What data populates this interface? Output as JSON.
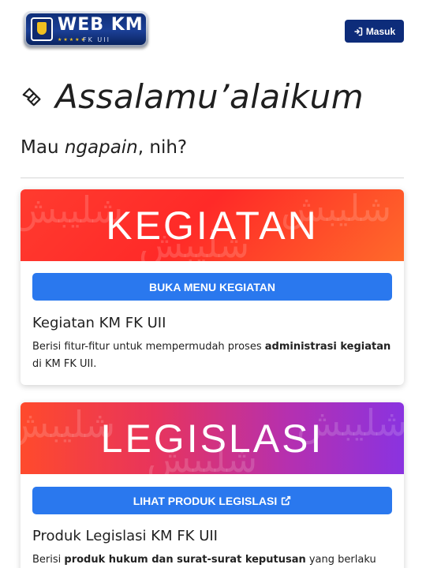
{
  "header": {
    "logo": {
      "main_text": "WEB KM",
      "sub_text": "FK UII",
      "stars": "★★★★★"
    },
    "login_label": "Masuk"
  },
  "greeting": {
    "text": "Assalamu’alaikum"
  },
  "question": {
    "prefix": "Mau ",
    "emphasis": "ngapain",
    "suffix": ", nih?"
  },
  "cards": [
    {
      "banner_title": "KEGIATAN",
      "button_label": "BUKA MENU KEGIATAN",
      "title": "Kegiatan KM FK UII",
      "desc_part1": "Berisi fitur-fitur untuk mempermudah proses ",
      "desc_bold1": "administrasi kegiatan",
      "desc_part2": " di KM FK UII."
    },
    {
      "banner_title": "LEGISLASI",
      "button_label": "LIHAT PRODUK LEGISLASI",
      "title": "Produk Legislasi KM FK UII",
      "desc_part1": "Berisi ",
      "desc_bold1": "produk hukum dan surat-surat keputusan",
      "desc_part2": " yang berlaku"
    }
  ],
  "banner_pattern_text": "شلیبش",
  "colors": {
    "login_bg": "#0d2c7a",
    "action_button": "#2a78ee",
    "banner_red": "#ff3b2f",
    "banner_purple": "#8a33e0"
  },
  "icons": {
    "login": "sign-in-icon",
    "greeting": "handshake-icon",
    "legislasi_button": "external-link-icon"
  }
}
